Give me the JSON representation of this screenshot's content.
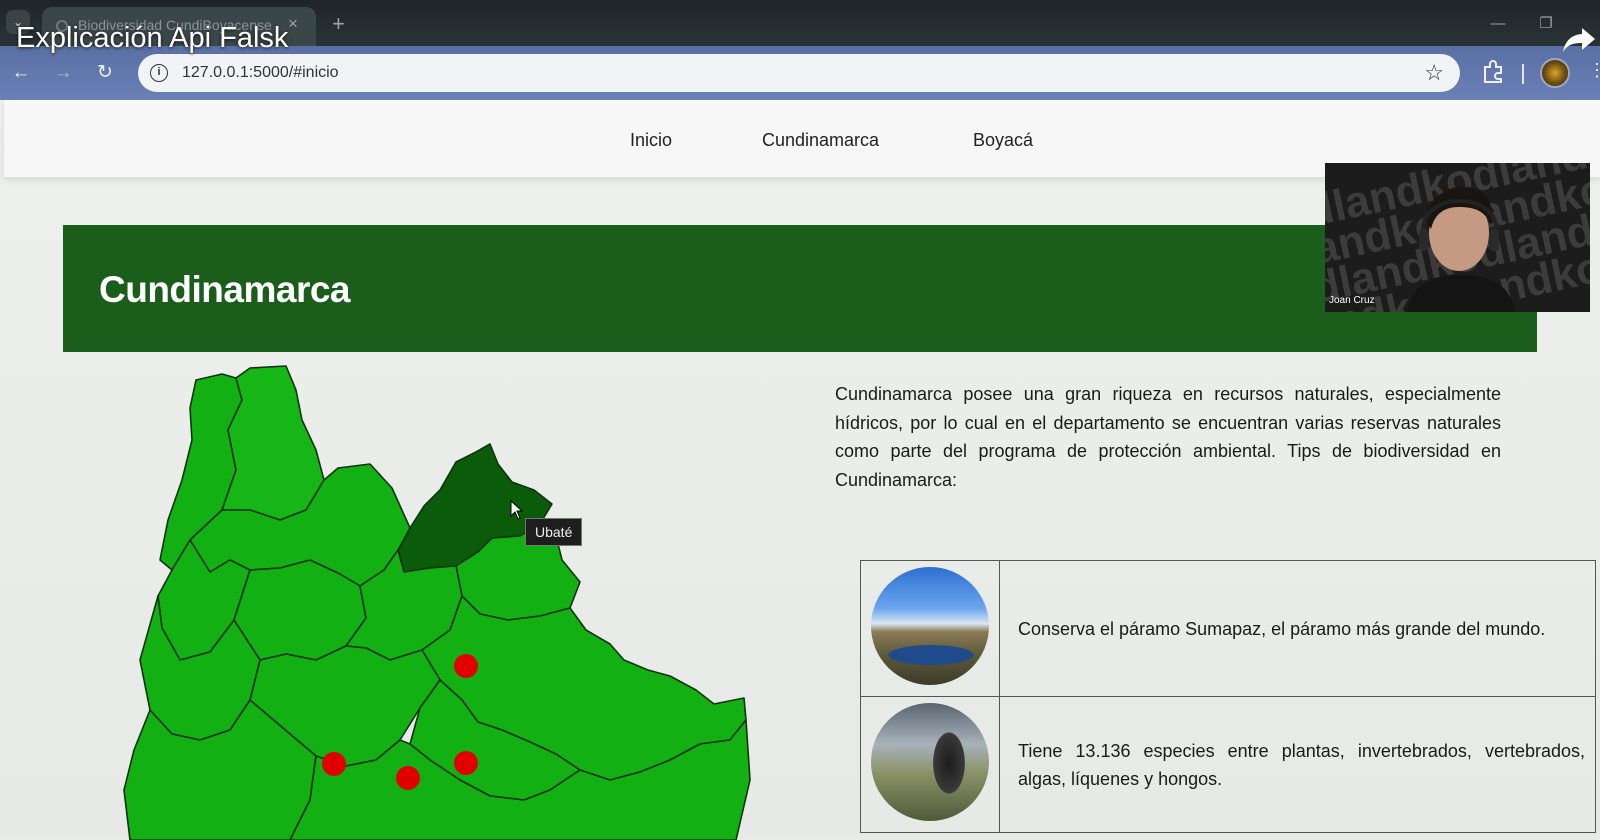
{
  "video": {
    "title": "Explicación Api Falsk"
  },
  "browser": {
    "tab_title": "Biodiversidad CundiBoyacense",
    "url": "127.0.0.1:5000/#inicio",
    "new_tab_label": "+",
    "close_tab_label": "×"
  },
  "site": {
    "nav": [
      "Inicio",
      "Cundinamarca",
      "Boyacá"
    ],
    "banner_title": "Cundinamarca",
    "intro": "Cundinamarca posee una gran riqueza en recursos naturales, especialmente hídricos, por lo cual en el departamento se encuentran varias reservas naturales como parte del programa de protección ambiental. Tips de biodiversidad en Cundinamarca:",
    "map_tooltip": "Ubaté",
    "tips": [
      {
        "text": "Conserva el páramo Sumapaz, el páramo más grande del mundo.",
        "image": "sumapaz-paramo-photo"
      },
      {
        "text": "Tiene 13.136 especies entre plantas, invertebrados, vertebrados, algas, líquenes y hongos.",
        "image": "frailejon-photo"
      }
    ]
  },
  "webcam": {
    "name": "Joan Cruz",
    "background_text": "dlandkodlandkod"
  },
  "colors": {
    "banner": "#1b5e1b",
    "region_fill": "#13b013",
    "region_highlight": "#0a5c0a",
    "marker": "#e00000",
    "toolbar": "#6178ae"
  }
}
